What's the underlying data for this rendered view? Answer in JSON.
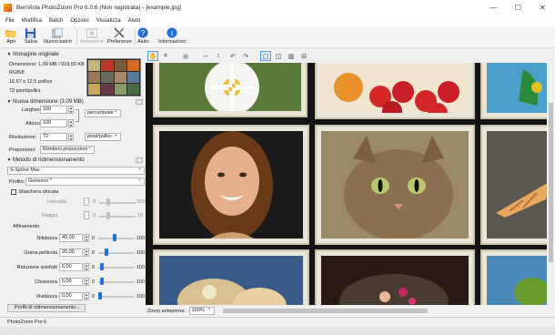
{
  "window": {
    "title": "BenVista PhotoZoom Pro 6.0.6 (Non registrata) - [example.jpg]",
    "minimize": "—",
    "maximize": "☐",
    "close": "✕"
  },
  "menu": [
    "File",
    "Modifica",
    "Batch",
    "Opzioni",
    "Visualizza",
    "Aiuto"
  ],
  "toolbar": {
    "open": "Apri",
    "save": "Salva",
    "new_batch": "Nuovo batch",
    "preview": "Anteprima",
    "preferences": "Preferenze",
    "help": "Aiuto",
    "info": "Informazioni"
  },
  "original": {
    "header": "Immagine originale",
    "dimension": "Dimensione: 1,09 MB / 919,50 KB",
    "mode": "RGB/8",
    "size_cm": "16,67 x 12,5 pollice",
    "resolution": "72 pixel/pollici"
  },
  "new_size": {
    "header": "Nuova dimensione (3,09 MB)",
    "width_label": "Larghezza",
    "width_value": "100",
    "height_label": "Altezza",
    "height_value": "100",
    "unit": "percentuale",
    "resolution_label": "Risoluzione:",
    "resolution_value": "72",
    "resolution_unit": "pixel/pollici",
    "proportions_label": "Proporzioni:",
    "proportions_value": "Mantieni proporzioni"
  },
  "method": {
    "header": "Metodo di ridimensionamento",
    "algorithm": "S-Spline Max",
    "profile_label": "Profilo:",
    "profile_value": "Generico *",
    "mask_label": "Maschera sfocata",
    "intensity_label": "Intensità",
    "radius_label": "Raggio",
    "min": "0",
    "max_intensity": "500",
    "max_radius": "10"
  },
  "refine": {
    "header": "Affinamento",
    "rows": [
      {
        "label": "Nitidezza",
        "value": "45,00",
        "min": "0",
        "max": "100",
        "level": 0.45
      },
      {
        "label": "Grana pellicola",
        "value": "20,00",
        "min": "0",
        "max": "100",
        "level": 0.2
      },
      {
        "label": "Riduzione artefatti",
        "value": "6,00",
        "min": "0",
        "max": "100",
        "level": 0.06
      },
      {
        "label": "Chiarezza",
        "value": "6,00",
        "min": "0",
        "max": "100",
        "level": 0.06
      },
      {
        "label": "Vividezza",
        "value": "0,00",
        "min": "0",
        "max": "100",
        "level": 0.0
      }
    ],
    "profiles_button": "Profili di ridimensionamento..."
  },
  "zoom": {
    "label": "Zoom anteprima:",
    "value": "100%"
  },
  "status": "PhotoZoom Pro 6",
  "colors": {
    "accent": "#1e6fd9",
    "preview_bg": "#141414",
    "frame": "#e9e5d8"
  }
}
